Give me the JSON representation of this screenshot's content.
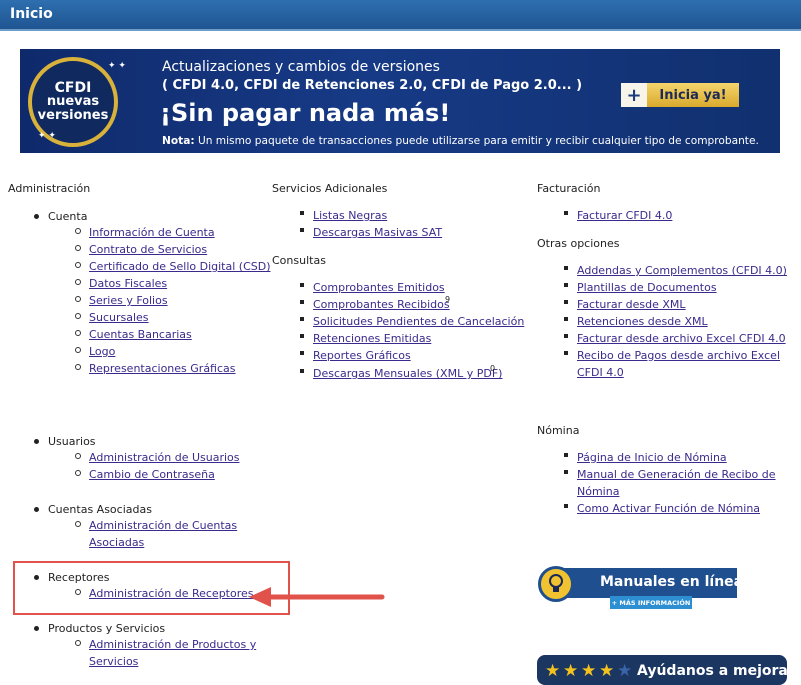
{
  "header": {
    "title": "Inicio"
  },
  "banner": {
    "badge": {
      "line1": "CFDI",
      "line2": "nuevas",
      "line3": "versiones"
    },
    "line1": "Actualizaciones y cambios de versiones",
    "line2": "( CFDI 4.0, CFDI de Retenciones 2.0, CFDI de Pago 2.0... )",
    "headline": "¡Sin pagar nada más!",
    "note_label": "Nota:",
    "note": " Un mismo paquete de transacciones puede utilizarse para emitir y recibir cualquier tipo de comprobante.",
    "cta_plus": "+",
    "cta_label": "Inicia ya!"
  },
  "admin": {
    "title": "Administración",
    "cuenta": {
      "label": "Cuenta",
      "links": [
        "Información de Cuenta",
        "Contrato de Servicios",
        "Certificado de Sello Digital (CSD)",
        "Datos Fiscales",
        "Series y Folios",
        "Sucursales",
        "Cuentas Bancarias",
        "Logo",
        "Representaciones Gráficas"
      ]
    },
    "usuarios": {
      "label": "Usuarios",
      "links": [
        "Administración de Usuarios",
        "Cambio de Contraseña"
      ]
    },
    "asociadas": {
      "label": "Cuentas Asociadas",
      "links": [
        "Administración de Cuentas",
        "Asociadas"
      ]
    },
    "receptores": {
      "label": "Receptores",
      "links": [
        "Administración de Receptores"
      ]
    },
    "productos": {
      "label": "Productos y Servicios",
      "links": [
        "Administración de Productos y",
        "Servicios"
      ]
    }
  },
  "servicios": {
    "title": "Servicios Adicionales",
    "links": [
      "Listas Negras",
      "Descargas Masivas SAT"
    ]
  },
  "consultas": {
    "title": "Consultas",
    "links": [
      "Comprobantes Emitidos",
      "Comprobantes Recibidos",
      "Solicitudes Pendientes de Cancelación",
      "Retenciones Emitidas",
      "Reportes Gráficos",
      "Descargas Mensuales (XML y PDF)"
    ],
    "badges": {
      "recibidos": "9",
      "descargas": "0"
    }
  },
  "facturacion": {
    "title": "Facturación",
    "links": [
      "Facturar CFDI 4.0"
    ]
  },
  "otras": {
    "title": "Otras opciones",
    "links": [
      "Addendas y Complementos (CFDI 4.0)",
      "Plantillas de Documentos",
      "Facturar desde XML",
      "Retenciones desde XML",
      "Facturar desde archivo Excel CFDI 4.0",
      "Recibo de Pagos desde archivo Excel",
      "CFDI 4.0"
    ]
  },
  "nomina": {
    "title": "Nómina",
    "links": [
      "Página de Inicio de Nómina",
      "Manual de Generación de Recibo de",
      "Nómina",
      "Como Activar Función de Nómina"
    ]
  },
  "manuales": {
    "title": "Manuales en línea",
    "more": "+ MÁS INFORMACIÓN"
  },
  "rating": {
    "text": "Ayúdanos a mejorar"
  },
  "colors": {
    "header": "#1f5591",
    "link": "#3b2a8c",
    "highlight": "#e0524a"
  }
}
